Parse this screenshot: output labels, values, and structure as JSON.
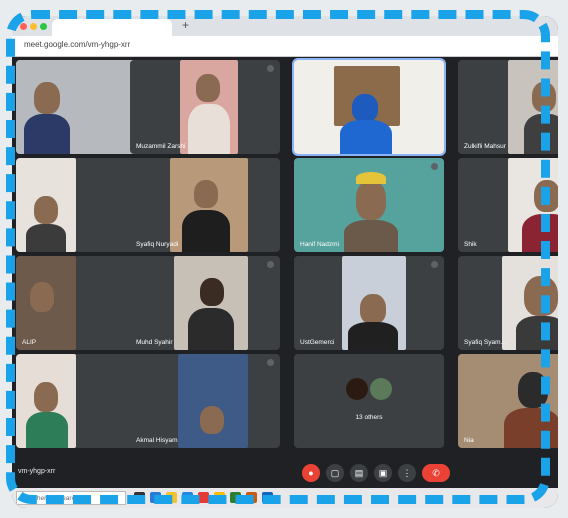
{
  "browser": {
    "url": "meet.google.com/vm-yhgp-xrr",
    "new_tab_icon": "+"
  },
  "tiles": [
    {
      "name": ""
    },
    {
      "name": "Muzammil Zarshi"
    },
    {
      "name": ""
    },
    {
      "name": "Zulkifli Mahsur"
    },
    {
      "name": ""
    },
    {
      "name": "Syafiq Nuryadi"
    },
    {
      "name": "Hanif Nadzmi"
    },
    {
      "name": "Shik"
    },
    {
      "name": "ALIP"
    },
    {
      "name": "Muhd Syahir"
    },
    {
      "name": "UstGemerci"
    },
    {
      "name": "Syafiq Syam..."
    },
    {
      "name": ""
    },
    {
      "name": "Akmal Hisyam"
    },
    {
      "name": "13 others"
    },
    {
      "name": "Nia"
    }
  ],
  "meeting_code": "vm-yhgp-xrr",
  "controls": {
    "mic_icon": "mic-off-icon",
    "camera_icon": "camera-icon",
    "captions_icon": "captions-icon",
    "present_icon": "present-icon",
    "more_icon": "more-icon",
    "hangup_icon": "hangup-icon"
  },
  "taskbar": {
    "search_placeholder": "Type here to search"
  },
  "colors": {
    "frame": "#1aa3e8",
    "hangup": "#ea4335",
    "active_speaker": "#8ab4f8"
  }
}
